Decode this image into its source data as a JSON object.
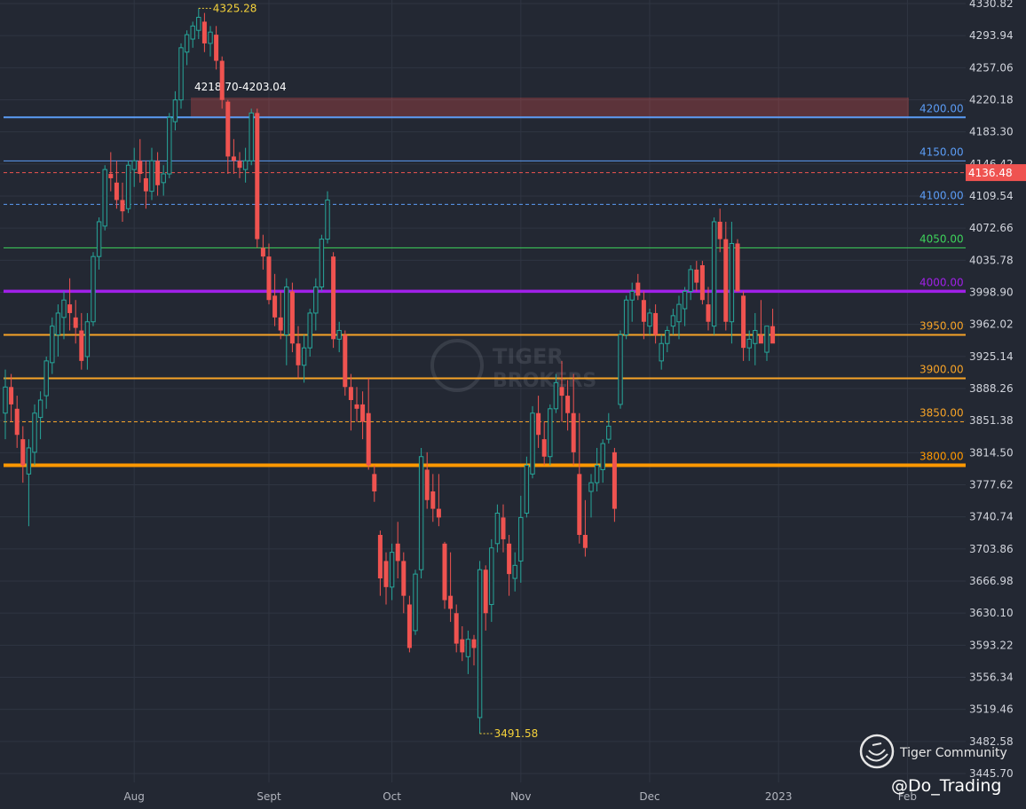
{
  "watermark": {
    "brand_line1": "TIGER",
    "brand_line2": "BROKERS",
    "community_label": "Tiger Community",
    "author_handle": "@Do_Trading"
  },
  "price_badge": {
    "value": "4136.48",
    "color": "#ef5350"
  },
  "colors": {
    "background": "#232833",
    "grid": "#2f3542",
    "up": "#26a69a",
    "down": "#ef5350",
    "axis_text": "#d1d4dc",
    "time_text": "#b2b5be"
  },
  "chart_data": {
    "type": "candlestick",
    "title": "",
    "xlabel": "",
    "ylabel": "",
    "ylim": [
      3445.7,
      4330.82
    ],
    "y_ticks": [
      3445.7,
      3482.58,
      3519.46,
      3556.34,
      3593.22,
      3630.1,
      3666.98,
      3703.86,
      3740.74,
      3777.62,
      3814.5,
      3851.38,
      3888.26,
      3925.14,
      3962.02,
      3998.9,
      4035.78,
      4072.66,
      4109.54,
      4146.42,
      4183.3,
      4220.18,
      4257.06,
      4293.94,
      4330.82
    ],
    "x_ticks": [
      {
        "label": "Aug",
        "index": 22
      },
      {
        "label": "Sept",
        "index": 45
      },
      {
        "label": "Oct",
        "index": 66
      },
      {
        "label": "Nov",
        "index": 88
      },
      {
        "label": "Dec",
        "index": 110
      },
      {
        "label": "2023",
        "index": 132
      },
      {
        "label": "Feb",
        "index": 154
      }
    ],
    "candles": [
      {
        "o": 3860,
        "h": 3910,
        "l": 3830,
        "c": 3890
      },
      {
        "o": 3890,
        "h": 3905,
        "l": 3850,
        "c": 3870
      },
      {
        "o": 3865,
        "h": 3880,
        "l": 3820,
        "c": 3835
      },
      {
        "o": 3830,
        "h": 3845,
        "l": 3780,
        "c": 3800
      },
      {
        "o": 3790,
        "h": 3830,
        "l": 3730,
        "c": 3820
      },
      {
        "o": 3815,
        "h": 3870,
        "l": 3800,
        "c": 3860
      },
      {
        "o": 3855,
        "h": 3885,
        "l": 3830,
        "c": 3875
      },
      {
        "o": 3880,
        "h": 3925,
        "l": 3865,
        "c": 3920
      },
      {
        "o": 3918,
        "h": 3970,
        "l": 3905,
        "c": 3960
      },
      {
        "o": 3950,
        "h": 3985,
        "l": 3925,
        "c": 3975
      },
      {
        "o": 3970,
        "h": 4000,
        "l": 3945,
        "c": 3990
      },
      {
        "o": 3985,
        "h": 4015,
        "l": 3955,
        "c": 3975
      },
      {
        "o": 3970,
        "h": 3990,
        "l": 3940,
        "c": 3958
      },
      {
        "o": 3955,
        "h": 3975,
        "l": 3910,
        "c": 3920
      },
      {
        "o": 3925,
        "h": 3975,
        "l": 3910,
        "c": 3965
      },
      {
        "o": 3965,
        "h": 4045,
        "l": 3960,
        "c": 4040
      },
      {
        "o": 4040,
        "h": 4085,
        "l": 4025,
        "c": 4080
      },
      {
        "o": 4075,
        "h": 4145,
        "l": 4070,
        "c": 4140
      },
      {
        "o": 4135,
        "h": 4160,
        "l": 4115,
        "c": 4130
      },
      {
        "o": 4125,
        "h": 4150,
        "l": 4095,
        "c": 4105
      },
      {
        "o": 4105,
        "h": 4125,
        "l": 4080,
        "c": 4092
      },
      {
        "o": 4095,
        "h": 4150,
        "l": 4090,
        "c": 4145
      },
      {
        "o": 4140,
        "h": 4165,
        "l": 4120,
        "c": 4150
      },
      {
        "o": 4150,
        "h": 4175,
        "l": 4125,
        "c": 4135
      },
      {
        "o": 4130,
        "h": 4150,
        "l": 4095,
        "c": 4115
      },
      {
        "o": 4115,
        "h": 4165,
        "l": 4105,
        "c": 4150
      },
      {
        "o": 4150,
        "h": 4160,
        "l": 4110,
        "c": 4122
      },
      {
        "o": 4125,
        "h": 4145,
        "l": 4110,
        "c": 4135
      },
      {
        "o": 4135,
        "h": 4205,
        "l": 4130,
        "c": 4200
      },
      {
        "o": 4195,
        "h": 4230,
        "l": 4185,
        "c": 4220
      },
      {
        "o": 4220,
        "h": 4285,
        "l": 4210,
        "c": 4280
      },
      {
        "o": 4275,
        "h": 4300,
        "l": 4260,
        "c": 4295
      },
      {
        "o": 4290,
        "h": 4310,
        "l": 4280,
        "c": 4305
      },
      {
        "o": 4300,
        "h": 4325.28,
        "l": 4290,
        "c": 4315
      },
      {
        "o": 4310,
        "h": 4320,
        "l": 4275,
        "c": 4285
      },
      {
        "o": 4285,
        "h": 4305,
        "l": 4270,
        "c": 4298
      },
      {
        "o": 4295,
        "h": 4305,
        "l": 4255,
        "c": 4265
      },
      {
        "o": 4265,
        "h": 4270,
        "l": 4210,
        "c": 4220
      },
      {
        "o": 4218,
        "h": 4220,
        "l": 4135,
        "c": 4155
      },
      {
        "o": 4155,
        "h": 4175,
        "l": 4135,
        "c": 4150
      },
      {
        "o": 4150,
        "h": 4160,
        "l": 4130,
        "c": 4142
      },
      {
        "o": 4140,
        "h": 4165,
        "l": 4125,
        "c": 4150
      },
      {
        "o": 4150,
        "h": 4210,
        "l": 4145,
        "c": 4205
      },
      {
        "o": 4205,
        "h": 4210,
        "l": 4050,
        "c": 4060
      },
      {
        "o": 4050,
        "h": 4065,
        "l": 4025,
        "c": 4040
      },
      {
        "o": 4040,
        "h": 4055,
        "l": 3985,
        "c": 3990
      },
      {
        "o": 3995,
        "h": 4020,
        "l": 3960,
        "c": 3970
      },
      {
        "o": 3970,
        "h": 4000,
        "l": 3945,
        "c": 3955
      },
      {
        "o": 3950,
        "h": 4015,
        "l": 3915,
        "c": 4005
      },
      {
        "o": 4000,
        "h": 4010,
        "l": 3930,
        "c": 3940
      },
      {
        "o": 3940,
        "h": 3960,
        "l": 3900,
        "c": 3915
      },
      {
        "o": 3915,
        "h": 3950,
        "l": 3895,
        "c": 3935
      },
      {
        "o": 3935,
        "h": 3980,
        "l": 3925,
        "c": 3975
      },
      {
        "o": 3975,
        "h": 4015,
        "l": 3955,
        "c": 4005
      },
      {
        "o": 4005,
        "h": 4065,
        "l": 4000,
        "c": 4060
      },
      {
        "o": 4060,
        "h": 4115,
        "l": 4055,
        "c": 4105
      },
      {
        "o": 4040,
        "h": 4045,
        "l": 3935,
        "c": 3945
      },
      {
        "o": 3945,
        "h": 3965,
        "l": 3930,
        "c": 3955
      },
      {
        "o": 3950,
        "h": 3955,
        "l": 3880,
        "c": 3890
      },
      {
        "o": 3890,
        "h": 3905,
        "l": 3840,
        "c": 3875
      },
      {
        "o": 3870,
        "h": 3890,
        "l": 3850,
        "c": 3865
      },
      {
        "o": 3870,
        "h": 3885,
        "l": 3830,
        "c": 3850
      },
      {
        "o": 3860,
        "h": 3900,
        "l": 3795,
        "c": 3800
      },
      {
        "o": 3790,
        "h": 3800,
        "l": 3758,
        "c": 3770
      },
      {
        "o": 3720,
        "h": 3725,
        "l": 3650,
        "c": 3670
      },
      {
        "o": 3690,
        "h": 3700,
        "l": 3640,
        "c": 3660
      },
      {
        "o": 3660,
        "h": 3710,
        "l": 3645,
        "c": 3700
      },
      {
        "o": 3710,
        "h": 3735,
        "l": 3670,
        "c": 3690
      },
      {
        "o": 3690,
        "h": 3700,
        "l": 3630,
        "c": 3650
      },
      {
        "o": 3640,
        "h": 3650,
        "l": 3585,
        "c": 3590
      },
      {
        "o": 3610,
        "h": 3680,
        "l": 3605,
        "c": 3675
      },
      {
        "o": 3680,
        "h": 3820,
        "l": 3670,
        "c": 3810
      },
      {
        "o": 3795,
        "h": 3815,
        "l": 3750,
        "c": 3760
      },
      {
        "o": 3770,
        "h": 3790,
        "l": 3735,
        "c": 3750
      },
      {
        "o": 3750,
        "h": 3790,
        "l": 3730,
        "c": 3740
      },
      {
        "o": 3710,
        "h": 3712,
        "l": 3635,
        "c": 3645
      },
      {
        "o": 3650,
        "h": 3700,
        "l": 3620,
        "c": 3635
      },
      {
        "o": 3630,
        "h": 3640,
        "l": 3585,
        "c": 3595
      },
      {
        "o": 3600,
        "h": 3615,
        "l": 3575,
        "c": 3585
      },
      {
        "o": 3580,
        "h": 3610,
        "l": 3560,
        "c": 3600
      },
      {
        "o": 3600,
        "h": 3605,
        "l": 3570,
        "c": 3590
      },
      {
        "o": 3510,
        "h": 3690,
        "l": 3491.58,
        "c": 3680
      },
      {
        "o": 3680,
        "h": 3685,
        "l": 3610,
        "c": 3630
      },
      {
        "o": 3640,
        "h": 3715,
        "l": 3620,
        "c": 3705
      },
      {
        "o": 3710,
        "h": 3755,
        "l": 3700,
        "c": 3745
      },
      {
        "o": 3740,
        "h": 3755,
        "l": 3700,
        "c": 3715
      },
      {
        "o": 3710,
        "h": 3720,
        "l": 3650,
        "c": 3675
      },
      {
        "o": 3670,
        "h": 3700,
        "l": 3655,
        "c": 3685
      },
      {
        "o": 3690,
        "h": 3765,
        "l": 3665,
        "c": 3740
      },
      {
        "o": 3745,
        "h": 3810,
        "l": 3740,
        "c": 3800
      },
      {
        "o": 3790,
        "h": 3868,
        "l": 3785,
        "c": 3860
      },
      {
        "o": 3860,
        "h": 3880,
        "l": 3820,
        "c": 3835
      },
      {
        "o": 3830,
        "h": 3850,
        "l": 3800,
        "c": 3810
      },
      {
        "o": 3810,
        "h": 3870,
        "l": 3800,
        "c": 3865
      },
      {
        "o": 3865,
        "h": 3905,
        "l": 3860,
        "c": 3895
      },
      {
        "o": 3890,
        "h": 3920,
        "l": 3850,
        "c": 3880
      },
      {
        "o": 3880,
        "h": 3898,
        "l": 3840,
        "c": 3860
      },
      {
        "o": 3860,
        "h": 3905,
        "l": 3800,
        "c": 3815
      },
      {
        "o": 3790,
        "h": 3860,
        "l": 3710,
        "c": 3720
      },
      {
        "o": 3720,
        "h": 3760,
        "l": 3695,
        "c": 3705
      },
      {
        "o": 3770,
        "h": 3790,
        "l": 3740,
        "c": 3780
      },
      {
        "o": 3780,
        "h": 3820,
        "l": 3770,
        "c": 3800
      },
      {
        "o": 3795,
        "h": 3830,
        "l": 3780,
        "c": 3825
      },
      {
        "o": 3830,
        "h": 3860,
        "l": 3825,
        "c": 3845
      },
      {
        "o": 3815,
        "h": 3820,
        "l": 3735,
        "c": 3750
      },
      {
        "o": 3870,
        "h": 3955,
        "l": 3865,
        "c": 3950
      },
      {
        "o": 3950,
        "h": 3995,
        "l": 3945,
        "c": 3990
      },
      {
        "o": 3990,
        "h": 4010,
        "l": 3965,
        "c": 4000
      },
      {
        "o": 4010,
        "h": 4020,
        "l": 3990,
        "c": 3995
      },
      {
        "o": 3990,
        "h": 4000,
        "l": 3945,
        "c": 3965
      },
      {
        "o": 3960,
        "h": 3980,
        "l": 3950,
        "c": 3975
      },
      {
        "o": 3975,
        "h": 3985,
        "l": 3940,
        "c": 3950
      },
      {
        "o": 3920,
        "h": 3950,
        "l": 3910,
        "c": 3940
      },
      {
        "o": 3940,
        "h": 3960,
        "l": 3930,
        "c": 3955
      },
      {
        "o": 3960,
        "h": 3980,
        "l": 3950,
        "c": 3972
      },
      {
        "o": 3965,
        "h": 3995,
        "l": 3945,
        "c": 3985
      },
      {
        "o": 3980,
        "h": 4005,
        "l": 3960,
        "c": 4000
      },
      {
        "o": 4000,
        "h": 4030,
        "l": 3990,
        "c": 4025
      },
      {
        "o": 4025,
        "h": 4035,
        "l": 4000,
        "c": 4010
      },
      {
        "o": 4030,
        "h": 4035,
        "l": 3985,
        "c": 3990
      },
      {
        "o": 3985,
        "h": 4005,
        "l": 3955,
        "c": 3965
      },
      {
        "o": 3960,
        "h": 4085,
        "l": 3950,
        "c": 4080
      },
      {
        "o": 4080,
        "h": 4095,
        "l": 4045,
        "c": 4060
      },
      {
        "o": 4060,
        "h": 4080,
        "l": 3955,
        "c": 3965
      },
      {
        "o": 3965,
        "h": 4080,
        "l": 3940,
        "c": 4055
      },
      {
        "o": 4055,
        "h": 4060,
        "l": 4000,
        "c": 4000
      },
      {
        "o": 3995,
        "h": 4000,
        "l": 3920,
        "c": 3935
      },
      {
        "o": 3935,
        "h": 3955,
        "l": 3920,
        "c": 3945
      },
      {
        "o": 3940,
        "h": 3975,
        "l": 3915,
        "c": 3955
      },
      {
        "o": 3950,
        "h": 3990,
        "l": 3945,
        "c": 3940
      },
      {
        "o": 3930,
        "h": 3945,
        "l": 3920,
        "c": 3960
      },
      {
        "o": 3960,
        "h": 3980,
        "l": 3945,
        "c": 3940
      }
    ],
    "price_levels": [
      {
        "value": 4200,
        "label": "4200.00",
        "color": "#5b9cf5",
        "width": 2,
        "dash": "none"
      },
      {
        "value": 4150,
        "label": "4150.00",
        "color": "#5b9cf5",
        "width": 1,
        "dash": "none"
      },
      {
        "value": 4100,
        "label": "4100.00",
        "color": "#5b9cf5",
        "width": 1,
        "dash": "4,3"
      },
      {
        "value": 4050,
        "label": "4050.00",
        "color": "#3ed35b",
        "width": 1,
        "dash": "none"
      },
      {
        "value": 4000,
        "label": "4000.00",
        "color": "#a020e8",
        "width": 3.5,
        "dash": "none"
      },
      {
        "value": 3950,
        "label": "3950.00",
        "color": "#f7a327",
        "width": 2,
        "dash": "none"
      },
      {
        "value": 3900,
        "label": "3900.00",
        "color": "#f7a327",
        "width": 2,
        "dash": "none"
      },
      {
        "value": 3850,
        "label": "3850.00",
        "color": "#f7a327",
        "width": 1,
        "dash": "4,3"
      },
      {
        "value": 3800,
        "label": "3800.00",
        "color": "#ff9800",
        "width": 4,
        "dash": "none"
      }
    ],
    "current_price_line": {
      "value": 4136.48,
      "color": "#ef5350"
    },
    "zone": {
      "low": 4203.04,
      "high": 4218.7,
      "label": "4218.70-4203.04",
      "color": "#ef5350"
    },
    "annotations": [
      {
        "text": "4325.28",
        "value": 4325.28,
        "candle_index": 33,
        "color": "#f5d23a"
      },
      {
        "text": "3491.58",
        "value": 3491.58,
        "candle_index": 81,
        "color": "#f5d23a"
      }
    ]
  }
}
